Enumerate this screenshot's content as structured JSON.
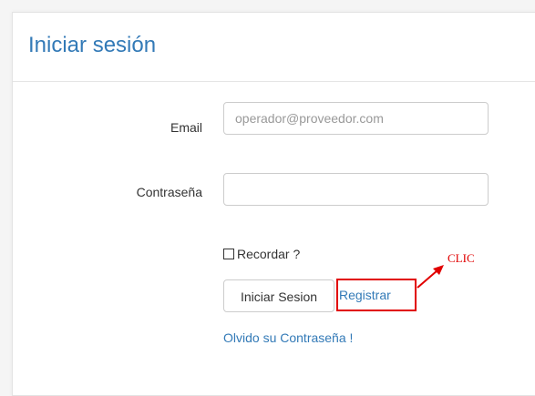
{
  "panel": {
    "title": "Iniciar sesión"
  },
  "form": {
    "email_label": "Email",
    "email_placeholder": "operador@proveedor.com",
    "email_value": "",
    "password_label": "Contraseña",
    "password_value": "",
    "remember_label": "Recordar ?",
    "remember_checked": false,
    "login_button": "Iniciar Sesion",
    "register_link": "Registrar",
    "forgot_link": "Olvido su Contraseña !"
  },
  "annotation": {
    "text": "CLIC",
    "color": "#e10000"
  },
  "colors": {
    "accent": "#337ab7",
    "annotation": "#e10000"
  }
}
